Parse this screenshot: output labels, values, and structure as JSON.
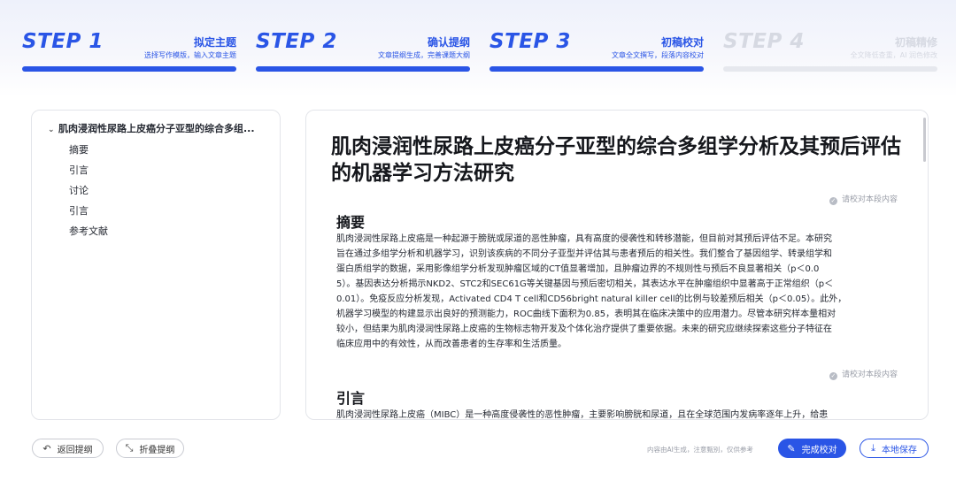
{
  "steps": [
    {
      "num": "STEP 1",
      "title": "拟定主题",
      "desc": "选择写作模版，输入文章主题",
      "active": true
    },
    {
      "num": "STEP 2",
      "title": "确认提纲",
      "desc": "文章提纲生成，完善课题大纲",
      "active": true
    },
    {
      "num": "STEP 3",
      "title": "初稿校对",
      "desc": "文章全文撰写，段落内容校对",
      "active": true
    },
    {
      "num": "STEP 4",
      "title": "初稿精修",
      "desc": "全文降低查重，AI 润色修改",
      "active": false
    }
  ],
  "outline": {
    "root": "肌肉浸润性尿路上皮癌分子亚型的综合多组...",
    "items": [
      "摘要",
      "引言",
      "讨论",
      "引言",
      "参考文献"
    ]
  },
  "document": {
    "title": "肌肉浸润性尿路上皮癌分子亚型的综合多组学分析及其预后评估的机器学习方法研究",
    "verify_label": "请校对本段内容",
    "sections": [
      {
        "heading": "摘要",
        "lines": [
          "肌肉浸润性尿路上皮癌是一种起源于膀胱或尿道的恶性肿瘤，具有高度的侵袭性和转移潜能，但目前对其预后评估不足。本研究",
          "旨在通过多组学分析和机器学习，识别该疾病的不同分子亚型并评估其与患者预后的相关性。我们整合了基因组学、转录组学和",
          "蛋白质组学的数据，采用影像组学分析发现肿瘤区域的CT值显著增加，且肿瘤边界的不规则性与预后不良显著相关（p＜0.0",
          "5）。基因表达分析揭示NKD2、STC2和SEC61G等关键基因与预后密切相关，其表达水平在肿瘤组织中显著高于正常组织（p＜",
          "0.01）。免疫反应分析发现，Activated CD4 T cell和CD56bright natural killer cell的比例与较差预后相关（p＜0.05）。此外，",
          "机器学习模型的构建显示出良好的预测能力，ROC曲线下面积为0.85，表明其在临床决策中的应用潜力。尽管本研究样本量相对",
          "较小，但结果为肌肉浸润性尿路上皮癌的生物标志物开发及个体化治疗提供了重要依据。未来的研究应继续探索这些分子特征在",
          "临床应用中的有效性，从而改善患者的生存率和生活质量。"
        ]
      },
      {
        "heading": "引言",
        "lines": [
          "肌肉浸润性尿路上皮癌（MIBC）是一种高度侵袭性的恶性肿瘤，主要影响膀胱和尿道，且在全球范围内发病率逐年上升，给患"
        ]
      }
    ]
  },
  "footer": {
    "back_label": "返回提纲",
    "fold_label": "折叠提纲",
    "note": "内容由AI生成，注意甄别，仅供参考",
    "finish_label": "完成校对",
    "save_label": "本地保存"
  },
  "colors": {
    "accent": "#2a55e6",
    "inactive": "#e6e8ee"
  }
}
